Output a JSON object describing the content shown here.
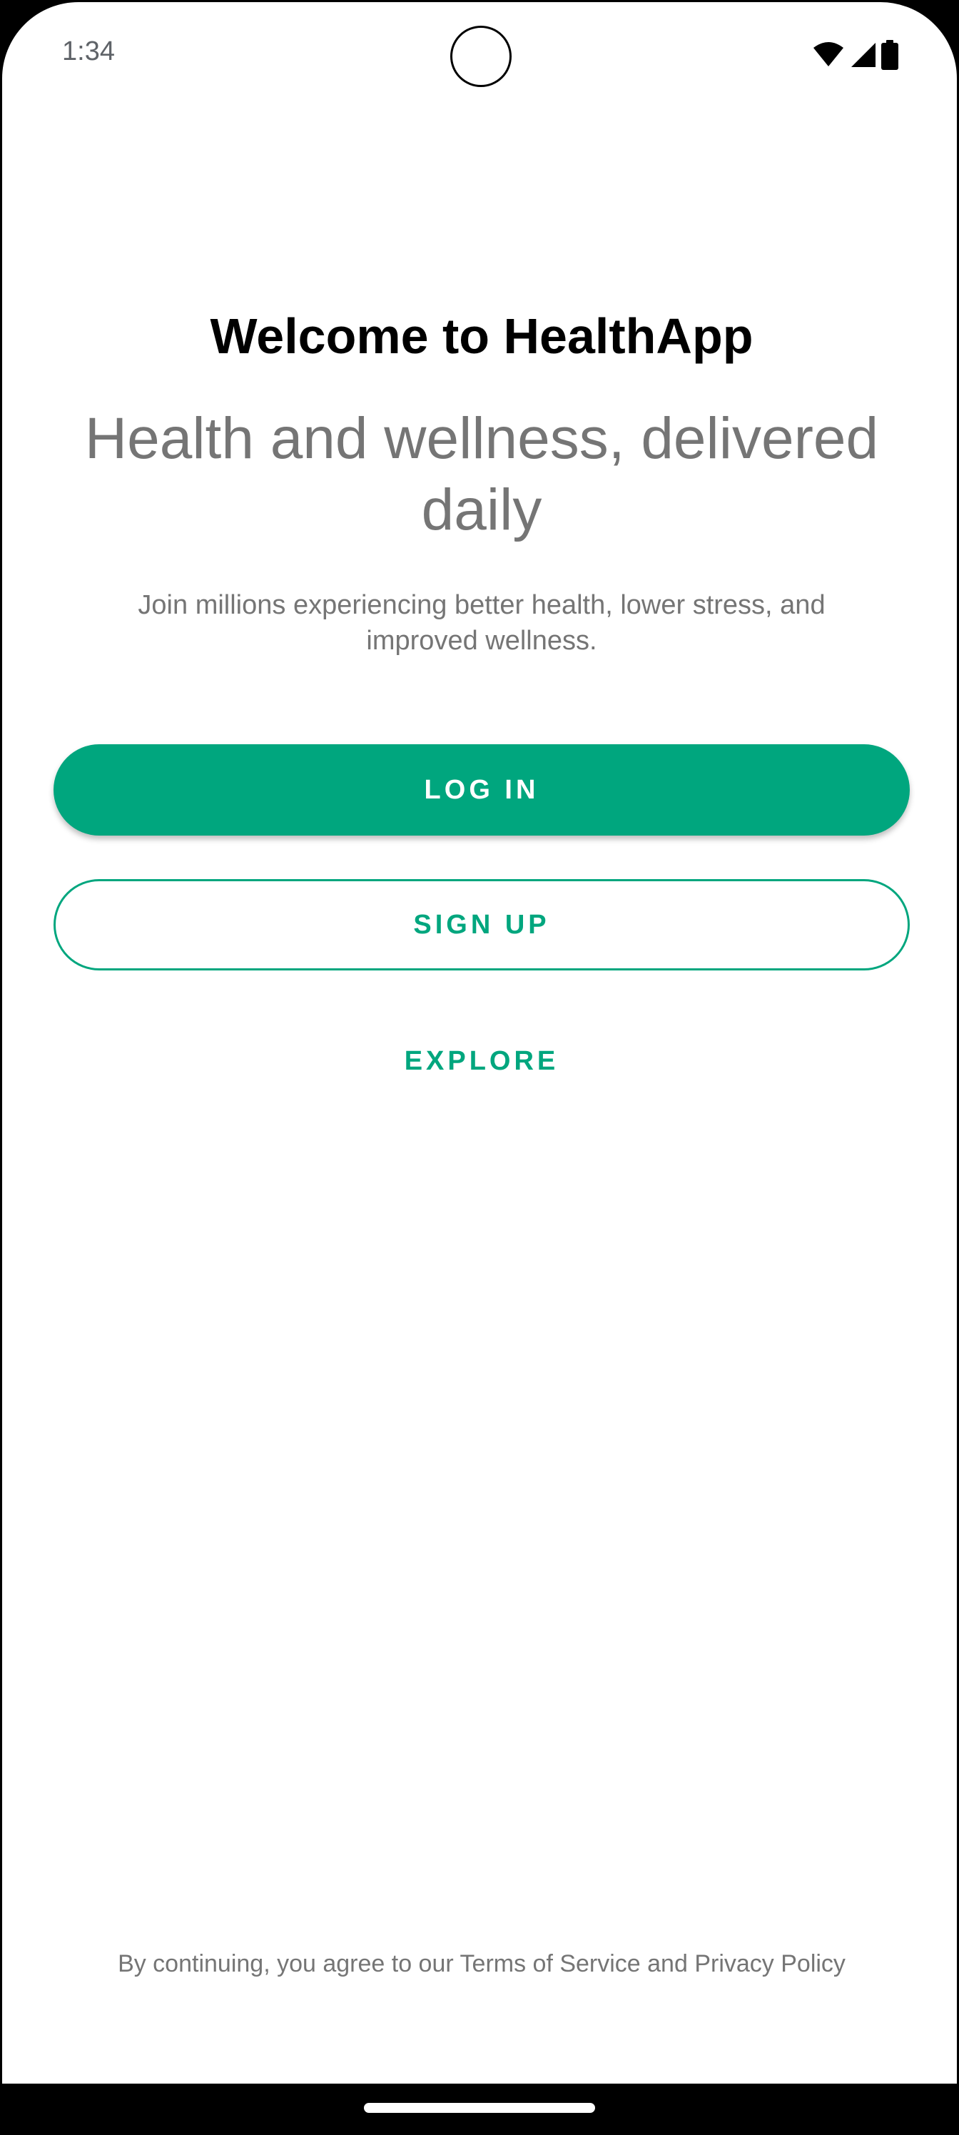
{
  "status_bar": {
    "time": "1:34",
    "icons": [
      "wifi-icon",
      "cellular-signal-icon",
      "battery-icon"
    ]
  },
  "welcome": {
    "title": "Welcome to HealthApp",
    "headline": "Health and wellness, delivered daily",
    "subtext": "Join millions experiencing better health, lower stress, and improved wellness."
  },
  "actions": {
    "login_label": "LOG IN",
    "signup_label": "SIGN UP",
    "explore_label": "EXPLORE"
  },
  "footer": {
    "legal_text": "By continuing, you agree to our Terms of Service and Privacy Policy"
  },
  "colors": {
    "accent": "#00a67e",
    "text_primary": "#000000",
    "text_secondary": "#757575"
  }
}
